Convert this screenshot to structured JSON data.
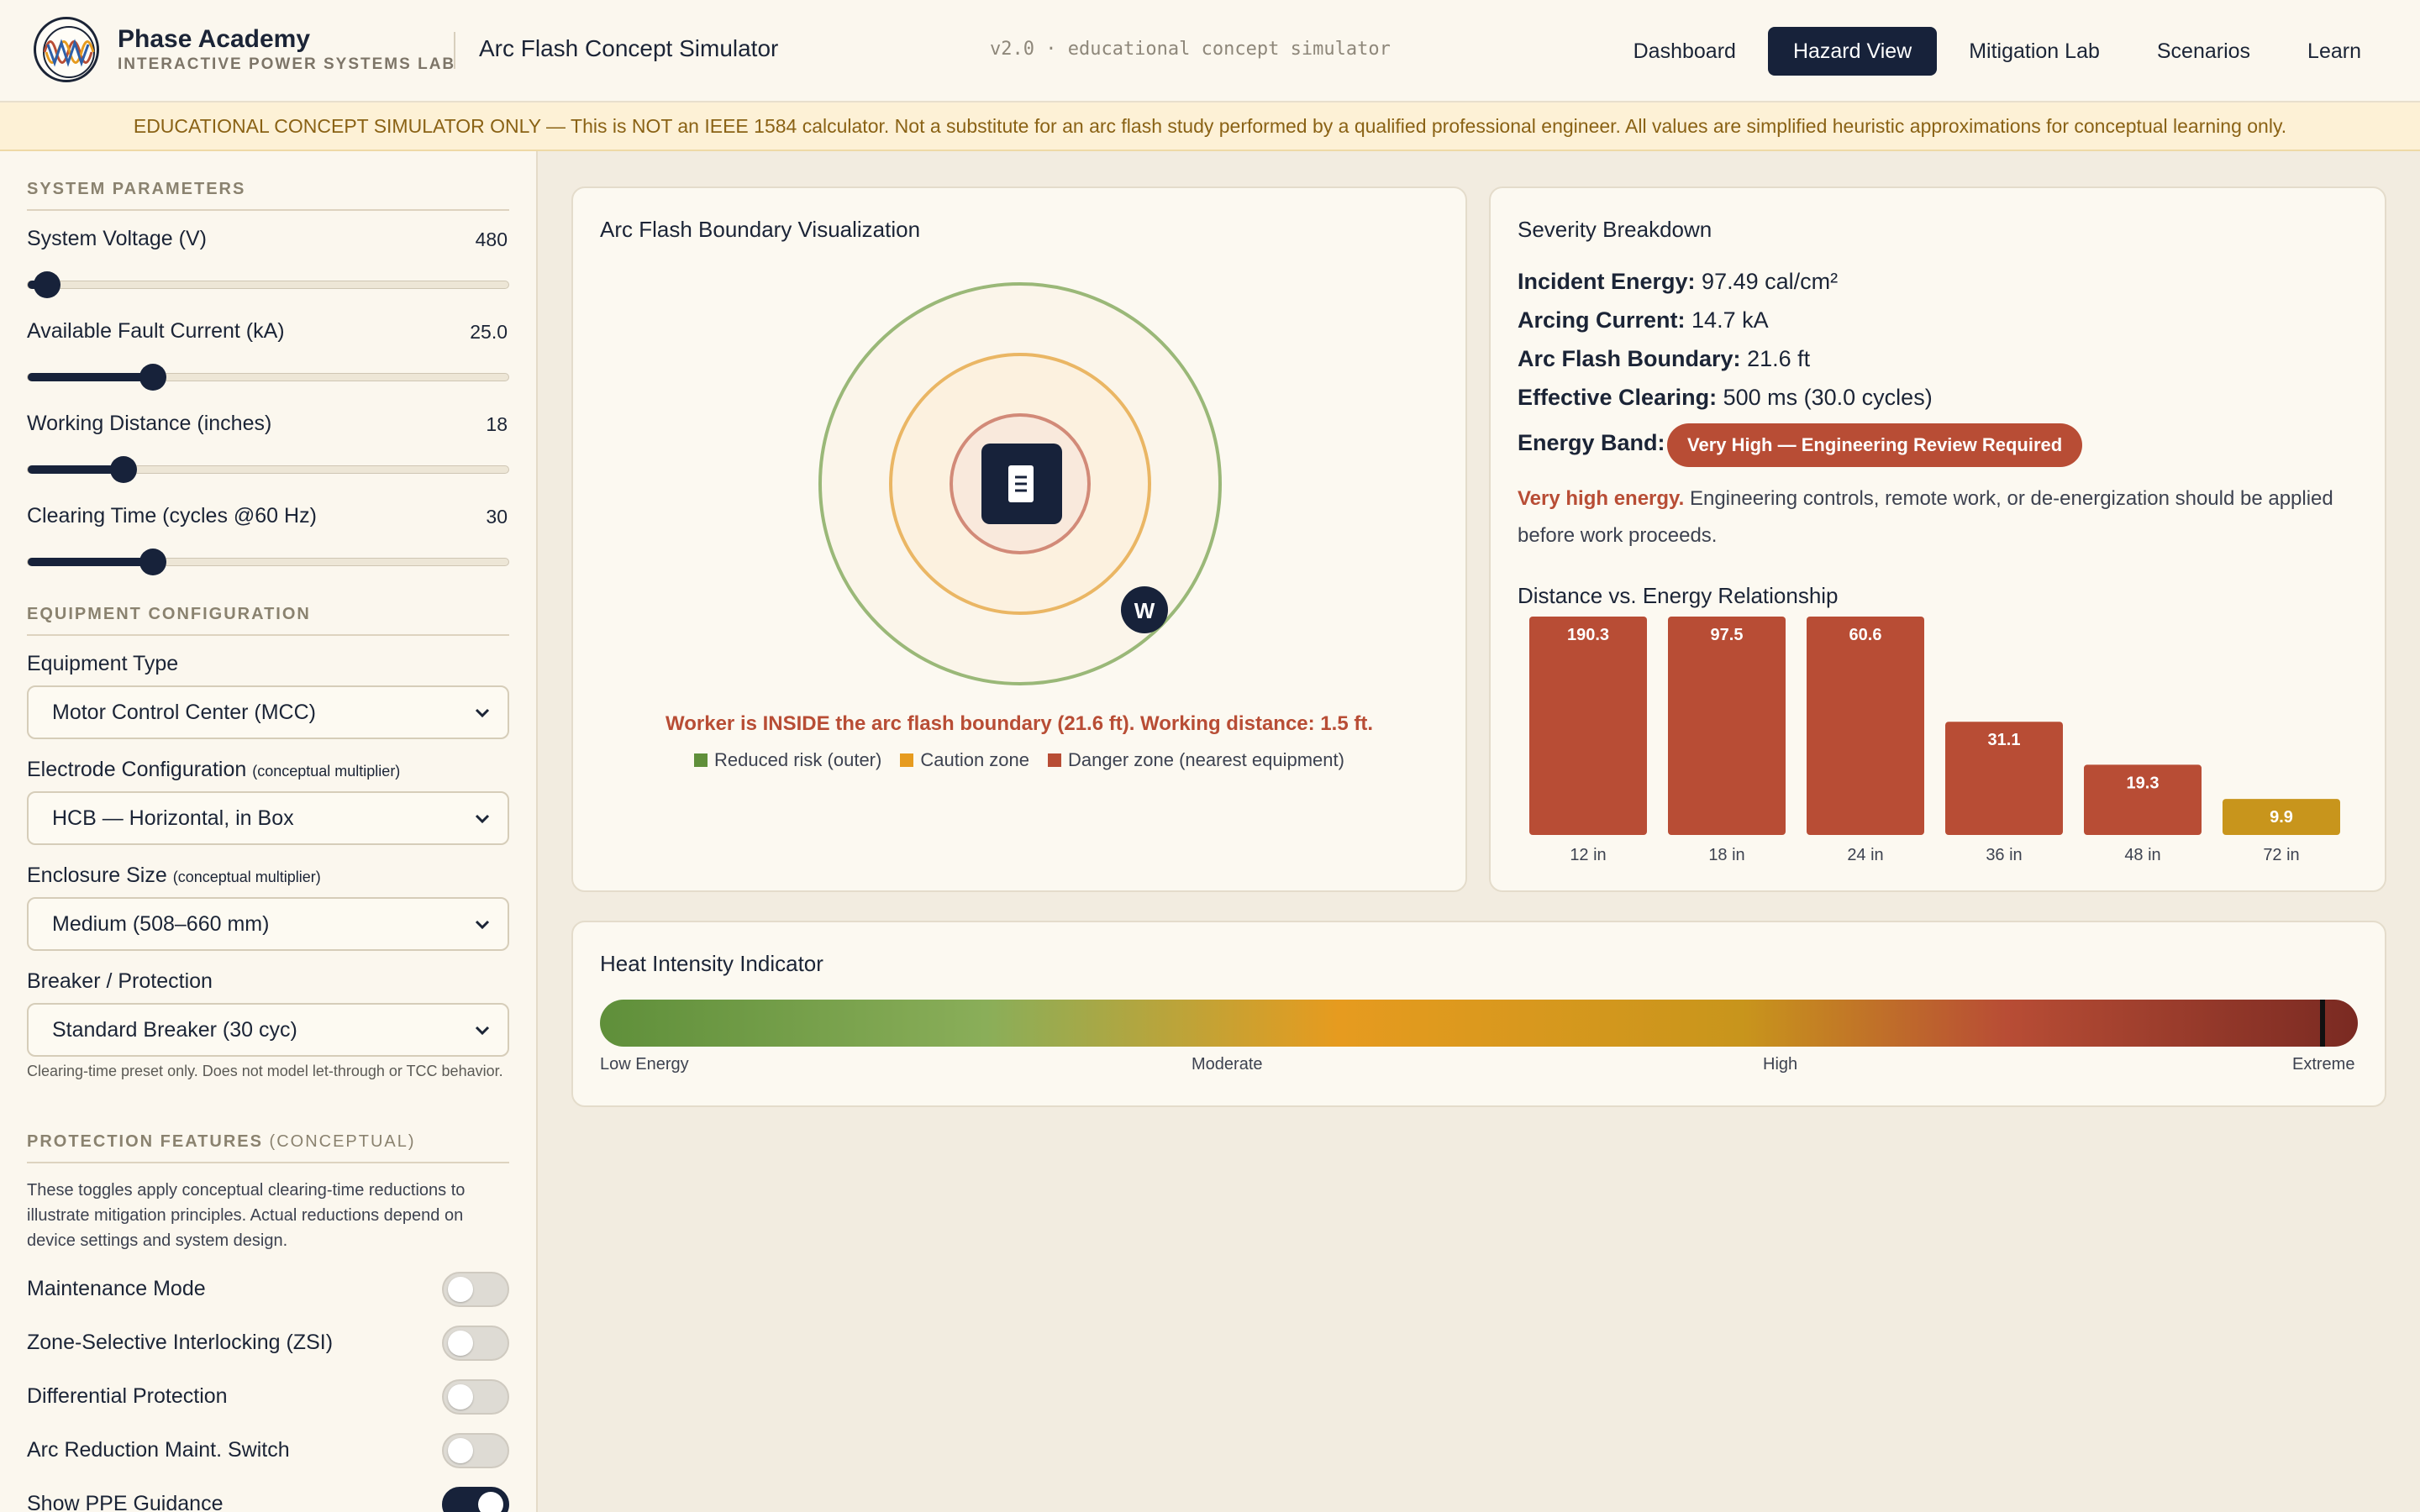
{
  "header": {
    "brand_name": "Phase Academy",
    "brand_sub": "INTERACTIVE POWER SYSTEMS LAB",
    "app_title": "Arc Flash Concept Simulator",
    "version": "v2.0 · educational concept simulator",
    "nav": [
      {
        "label": "Dashboard",
        "active": false
      },
      {
        "label": "Hazard View",
        "active": true
      },
      {
        "label": "Mitigation Lab",
        "active": false
      },
      {
        "label": "Scenarios",
        "active": false
      },
      {
        "label": "Learn",
        "active": false
      }
    ]
  },
  "banner": "EDUCATIONAL CONCEPT SIMULATOR ONLY — This is NOT an IEEE 1584 calculator. Not a substitute for an arc flash study performed by a qualified professional engineer. All values are simplified heuristic approximations for conceptual learning only.",
  "sidebar": {
    "system_heading": "SYSTEM PARAMETERS",
    "params": [
      {
        "label": "System Voltage (V)",
        "value": "480",
        "fraction": 0.04
      },
      {
        "label": "Available Fault Current (kA)",
        "value": "25.0",
        "fraction": 0.26
      },
      {
        "label": "Working Distance (inches)",
        "value": "18",
        "fraction": 0.2
      },
      {
        "label": "Clearing Time (cycles @60 Hz)",
        "value": "30",
        "fraction": 0.26
      }
    ],
    "equipment_heading": "EQUIPMENT CONFIGURATION",
    "equipment_type": {
      "label": "Equipment Type",
      "value": "Motor Control Center (MCC)"
    },
    "electrode": {
      "label": "Electrode Configuration",
      "note": "(conceptual multiplier)",
      "value": "HCB — Horizontal, in Box"
    },
    "enclosure": {
      "label": "Enclosure Size",
      "note": "(conceptual multiplier)",
      "value": "Medium (508–660 mm)"
    },
    "breaker": {
      "label": "Breaker / Protection",
      "value": "Standard Breaker (30 cyc)"
    },
    "breaker_hint": "Clearing-time preset only. Does not model let-through or TCC behavior.",
    "protection_heading": "PROTECTION FEATURES",
    "protection_heading_light": "(CONCEPTUAL)",
    "protection_desc": "These toggles apply conceptual clearing-time reductions to illustrate mitigation principles. Actual reductions depend on device settings and system design.",
    "toggles": [
      {
        "label": "Maintenance Mode",
        "on": false
      },
      {
        "label": "Zone-Selective Interlocking (ZSI)",
        "on": false
      },
      {
        "label": "Differential Protection",
        "on": false
      },
      {
        "label": "Arc Reduction Maint. Switch",
        "on": false
      },
      {
        "label": "Show PPE Guidance",
        "on": true
      }
    ]
  },
  "viz": {
    "title": "Arc Flash Boundary Visualization",
    "worker_badge": "W",
    "worker_message": "Worker is INSIDE the arc flash boundary (21.6 ft). Working distance: 1.5 ft.",
    "legend": [
      {
        "label": "Reduced risk (outer)",
        "color": "#5f8f3a"
      },
      {
        "label": "Caution zone",
        "color": "#e69b1f"
      },
      {
        "label": "Danger zone (nearest equipment)",
        "color": "#b84d35"
      }
    ]
  },
  "severity": {
    "title": "Severity Breakdown",
    "incident_energy_label": "Incident Energy:",
    "incident_energy": "97.49 cal/cm²",
    "arcing_current_label": "Arcing Current:",
    "arcing_current": "14.7 kA",
    "boundary_label": "Arc Flash Boundary:",
    "boundary": "21.6 ft",
    "clearing_label": "Effective Clearing:",
    "clearing": "500 ms (30.0 cycles)",
    "band_label": "Energy Band:",
    "band": "Very High — Engineering Review Required",
    "advice_lead": "Very high energy.",
    "advice": "Engineering controls, remote work, or de-energization should be applied before work proceeds.",
    "chart_title": "Distance vs. Energy Relationship"
  },
  "chart_data": {
    "type": "bar",
    "title": "Distance vs. Energy Relationship",
    "categories": [
      "12 in",
      "18 in",
      "24 in",
      "36 in",
      "48 in",
      "72 in"
    ],
    "values": [
      190.3,
      97.5,
      60.6,
      31.1,
      19.3,
      9.9
    ],
    "labels": [
      "190.3",
      "97.5",
      "60.6",
      "31.1",
      "19.3",
      "9.9"
    ],
    "ylim": [
      0,
      60
    ],
    "colors": [
      "#b84d35",
      "#b84d35",
      "#b84d35",
      "#b84d35",
      "#b84d35",
      "#c8951c"
    ],
    "xlabel": "",
    "ylabel": ""
  },
  "heat": {
    "title": "Heat Intensity Indicator",
    "labels": [
      "Low Energy",
      "Moderate",
      "High",
      "Extreme"
    ],
    "level": 0.98
  }
}
